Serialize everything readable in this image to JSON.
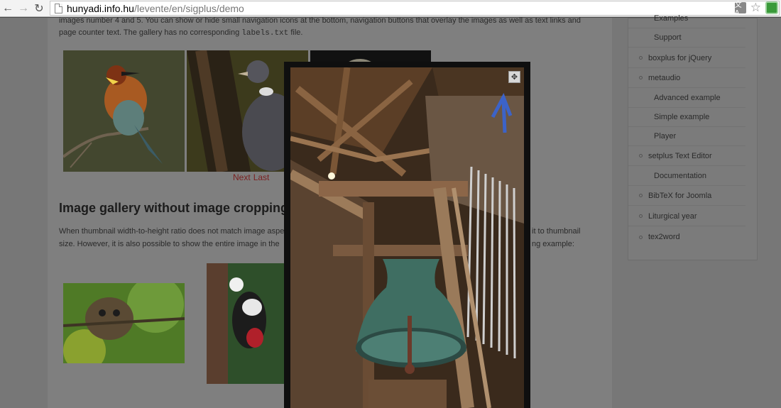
{
  "browser": {
    "url_host": "hunyadi.info.hu",
    "url_path": "/levente/en/sigplus/demo",
    "translate_label": "文A"
  },
  "page": {
    "intro_line1": "images number 4 and 5. You can show or hide small navigation icons at the bottom, navigation buttons that overlay the images as well as text links and",
    "intro_line2_a": "page counter text. The gallery has no corresponding ",
    "intro_line2_code": "labels.txt",
    "intro_line2_b": " file.",
    "nav_next": "Next",
    "nav_last": "Last",
    "heading": "Image gallery without image cropping",
    "para_line1_a": "When thumbnail width-to-height ratio does not match image aspe",
    "para_line1_b": "it to thumbnail",
    "para_line2_a": "size. However, it is also possible to show the entire image in the",
    "para_line2_b": "ng example:"
  },
  "sidebar": {
    "items": [
      {
        "label": "Examples",
        "sub": true
      },
      {
        "label": "Support",
        "sub": true
      },
      {
        "label": "boxplus for jQuery",
        "sub": false
      },
      {
        "label": "metaudio",
        "sub": false
      },
      {
        "label": "Advanced example",
        "sub": true
      },
      {
        "label": "Simple example",
        "sub": true
      },
      {
        "label": "Player",
        "sub": true
      },
      {
        "label": "setplus Text Editor",
        "sub": false
      },
      {
        "label": "Documentation",
        "sub": true
      },
      {
        "label": "BibTeX for Joomla",
        "sub": false
      },
      {
        "label": "Liturgical year",
        "sub": false
      },
      {
        "label": "tex2word",
        "sub": false
      }
    ]
  },
  "lightbox": {
    "fullscreen_icon": "fullscreen-icon"
  }
}
